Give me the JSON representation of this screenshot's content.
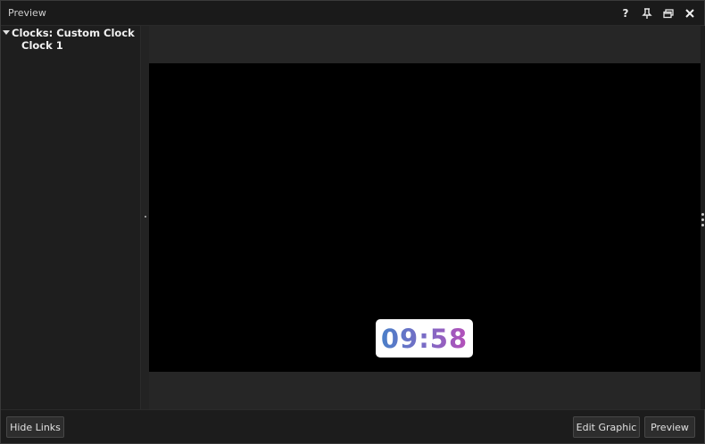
{
  "window": {
    "title": "Preview"
  },
  "title_controls": [
    {
      "icon": "help-icon",
      "label": "?"
    },
    {
      "icon": "pin-icon"
    },
    {
      "icon": "restore-icon"
    },
    {
      "icon": "close-icon"
    }
  ],
  "tree": {
    "parent_label": "Clocks: Custom Clock",
    "child_label": "Clock 1"
  },
  "preview": {
    "clock_text": "09:58",
    "clock_gradient": [
      "#4a7fc8",
      "#b54fb8"
    ],
    "canvas_color": "#000000"
  },
  "footer": {
    "hide_links_label": "Hide Links",
    "edit_graphic_label": "Edit Graphic",
    "preview_label": "Preview"
  }
}
